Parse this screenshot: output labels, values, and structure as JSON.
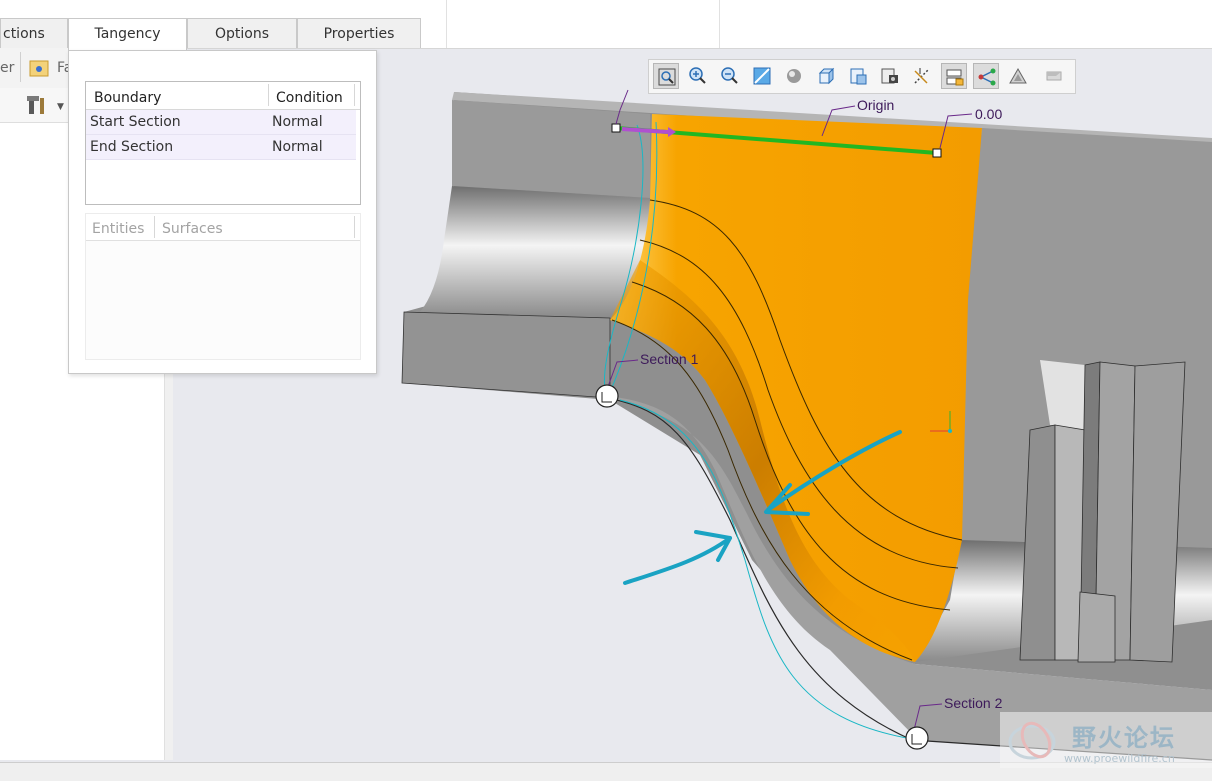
{
  "tabs": [
    {
      "label": "ctions"
    },
    {
      "label": "Tangency"
    },
    {
      "label": "Options"
    },
    {
      "label": "Properties"
    }
  ],
  "left_panel": {
    "truncated_label_1": "er",
    "truncated_label_2": "Fa"
  },
  "tangency_panel": {
    "boundary_table": {
      "columns": [
        "Boundary",
        "Condition"
      ],
      "rows": [
        {
          "boundary": "Start Section",
          "condition": "Normal"
        },
        {
          "boundary": "End Section",
          "condition": "Normal"
        }
      ]
    },
    "references_table": {
      "columns": [
        "Entities",
        "Surfaces"
      ]
    }
  },
  "view_toolbar": {
    "icons": [
      "refit-icon",
      "zoom-in-icon",
      "zoom-out-icon",
      "repaint-icon",
      "display-style-icon",
      "saved-orientations-icon",
      "view-manager-icon",
      "named-views-icon",
      "perspective-icon",
      "datum-display-filters-icon",
      "annotation-display-icon",
      "spin-center-icon",
      "appearance-icon"
    ]
  },
  "viewport": {
    "labels": {
      "origin": "Origin",
      "value": "0.00",
      "section_1": "Section 1",
      "section_2": "Section 2"
    },
    "colors": {
      "surface": "#f7a400",
      "model_gray": "#8f8f8f",
      "trajectory": "#22b722",
      "annotation_arrow": "#1aa3c3"
    }
  },
  "watermark": {
    "text": "野火论坛",
    "url": "www.proewildfire.cn"
  }
}
